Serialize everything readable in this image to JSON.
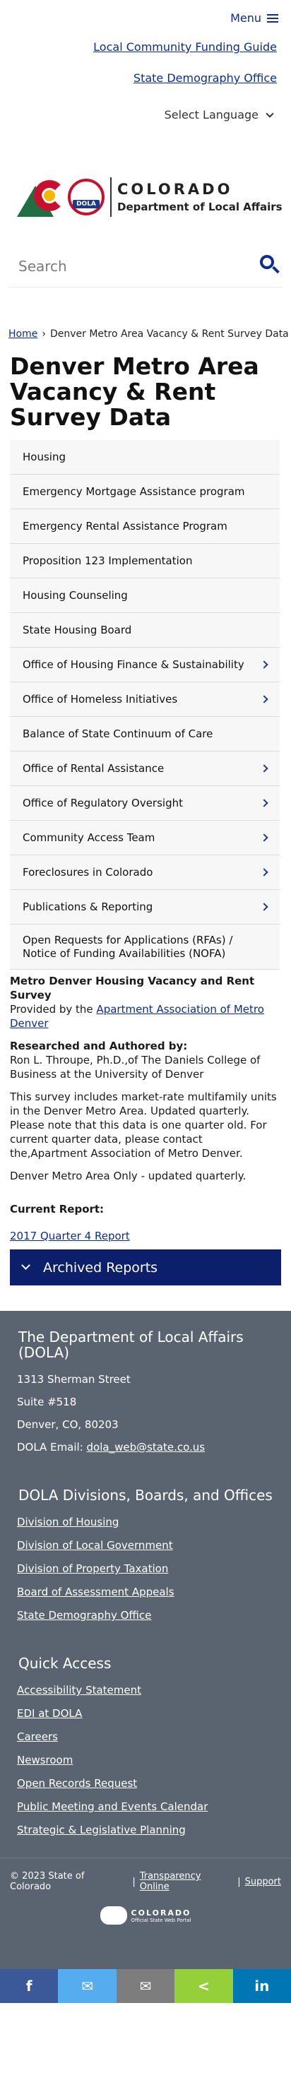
{
  "header": {
    "menu_label": "Menu",
    "util_links": [
      "Local Community Funding Guide",
      "State Demography Office"
    ],
    "language_label": "Select Language"
  },
  "logo": {
    "seal_text": "DOLA",
    "line1": "COLORADO",
    "line2": "Department of Local Affairs"
  },
  "search": {
    "placeholder": "Search"
  },
  "breadcrumb": {
    "home": "Home",
    "current": "Denver Metro Area Vacancy & Rent Survey Data"
  },
  "page_title": "Denver Metro Area Vacancy & Rent Survey Data",
  "sidenav": [
    {
      "label": "Housing",
      "has_children": false
    },
    {
      "label": "Emergency Mortgage Assistance program",
      "has_children": false
    },
    {
      "label": "Emergency Rental Assistance Program",
      "has_children": false
    },
    {
      "label": "Proposition 123 Implementation",
      "has_children": false
    },
    {
      "label": "Housing Counseling",
      "has_children": false
    },
    {
      "label": "State Housing Board",
      "has_children": false
    },
    {
      "label": "Office of Housing Finance & Sustainability",
      "has_children": true
    },
    {
      "label": "Office of Homeless Initiatives",
      "has_children": true
    },
    {
      "label": "Balance of State Continuum of Care",
      "has_children": false
    },
    {
      "label": "Office of Rental Assistance",
      "has_children": true
    },
    {
      "label": "Office of Regulatory Oversight",
      "has_children": true
    },
    {
      "label": "Community Access Team",
      "has_children": true
    },
    {
      "label": "Foreclosures in Colorado",
      "has_children": true
    },
    {
      "label": "Publications & Reporting",
      "has_children": true
    },
    {
      "label": "Open Requests for Applications (RFAs) / Notice of Funding Availabilities (NOFA)",
      "has_children": false
    }
  ],
  "content": {
    "survey_title": "Metro Denver Housing Vacancy and Rent Survey",
    "provided_by": "Provided by the ",
    "provider_link": "Apartment Association of Metro Denver",
    "authored_heading": "Researched and Authored by:",
    "authored_text": "Ron L. Throupe, Ph.D.,of The Daniels College of Business at the University of Denver",
    "description": "This survey includes market-rate multifamily units in the Denver Metro Area. Updated quarterly. Please note that this data is one quarter old. For current quarter data, please contact the,Apartment Association of Metro Denver.",
    "scope": "Denver Metro Area Only - updated quarterly."
  },
  "current_report": {
    "heading": "Current Report:",
    "link": "2017 Quarter 4 Report"
  },
  "archived": {
    "label": "Archived Reports"
  },
  "footer": {
    "org_title": "The Department of Local Affairs (DOLA)",
    "address": [
      "1313 Sherman Street",
      "Suite  #518",
      "Denver, CO, 80203"
    ],
    "email_label": "DOLA Email: ",
    "email": "dola_web@state.co.us",
    "divisions_title": "DOLA Divisions, Boards, and Offices",
    "divisions": [
      "Division of Housing",
      "Division of Local Government",
      "Division of Property Taxation",
      "Board of Assessment Appeals",
      "State Demography Office"
    ],
    "quick_title": "Quick Access",
    "quick": [
      "Accessibility Statement",
      "EDI at DOLA",
      "Careers",
      "Newsroom",
      "Open Records Request",
      "Public Meeting and Events Calendar",
      "Strategic & Legislative Planning"
    ]
  },
  "bottom": {
    "copyright": "© 2023 State of Colorado",
    "sep": "|",
    "links": [
      "Transparency Online",
      "Support"
    ],
    "portal_name": "COLORADO",
    "portal_sub": "Official State Web Portal"
  },
  "share": [
    {
      "icon": "facebook-icon",
      "glyph": "f",
      "color": "#3b5998"
    },
    {
      "icon": "twitter-icon",
      "glyph": "✉",
      "color": "#55acee"
    },
    {
      "icon": "email-icon",
      "glyph": "✉",
      "color": "#7d7d7d"
    },
    {
      "icon": "sharethis-icon",
      "glyph": "<",
      "color": "#95d03a"
    },
    {
      "icon": "linkedin-icon",
      "glyph": "in",
      "color": "#0077b5"
    }
  ]
}
